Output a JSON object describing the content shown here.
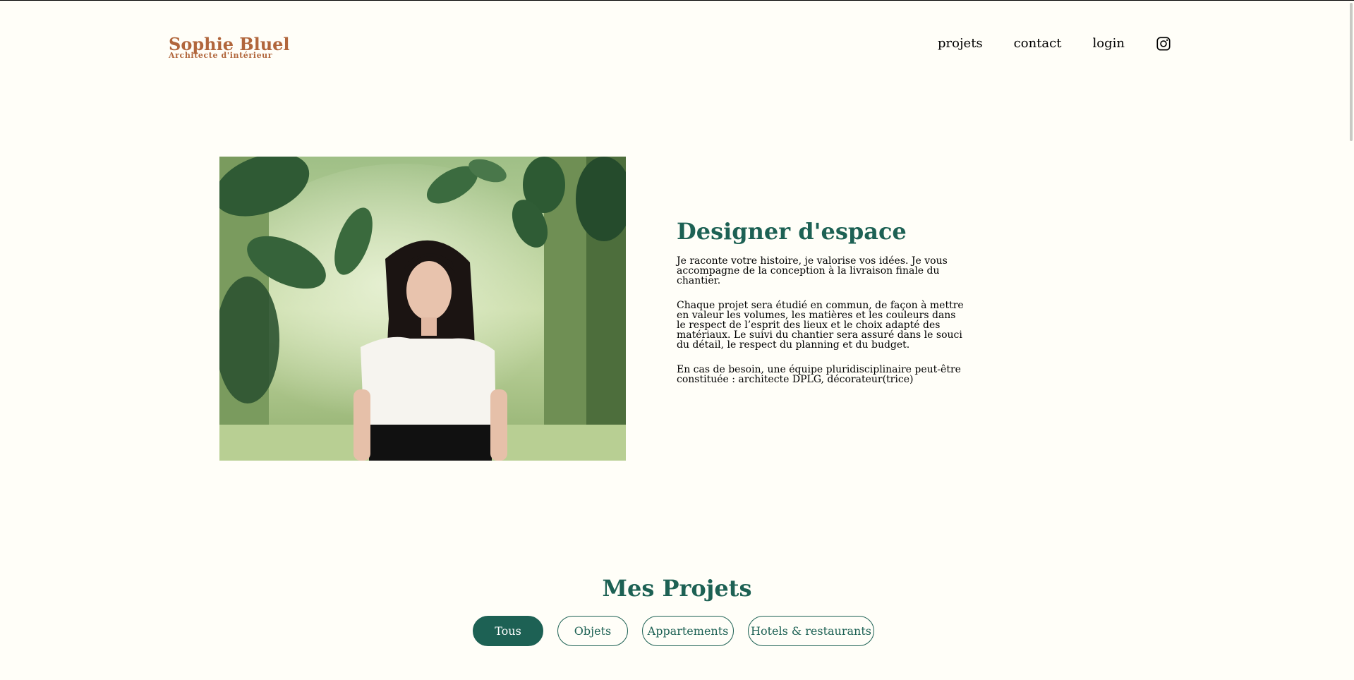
{
  "header": {
    "logo_name": "Sophie Bluel",
    "logo_subtitle": "Architecte d'intérieur",
    "nav": {
      "projets": "projets",
      "contact": "contact",
      "login": "login"
    },
    "instagram_icon": "instagram-icon"
  },
  "intro": {
    "title": "Designer d'espace",
    "paragraphs": [
      "Je raconte votre histoire, je valorise vos idées. Je vous accompagne de la conception à la livraison finale du chantier.",
      "Chaque projet sera étudié en commun, de façon à mettre en valeur les volumes, les matières et les couleurs dans le respect de l’esprit des lieux et le choix adapté des matériaux. Le suivi du chantier sera assuré dans le souci du détail, le respect du planning et du budget.",
      "En cas de besoin, une équipe pluridisciplinaire peut-être constituée : architecte DPLG, décorateur(trice)"
    ]
  },
  "portfolio": {
    "title": "Mes Projets",
    "filters": [
      "Tous",
      "Objets",
      "Appartements",
      "Hotels & restaurants"
    ],
    "active_filter": "Tous"
  },
  "colors": {
    "brand_green": "#1D6154",
    "logo_brown": "#B1663C",
    "background": "#FFFEF8"
  }
}
